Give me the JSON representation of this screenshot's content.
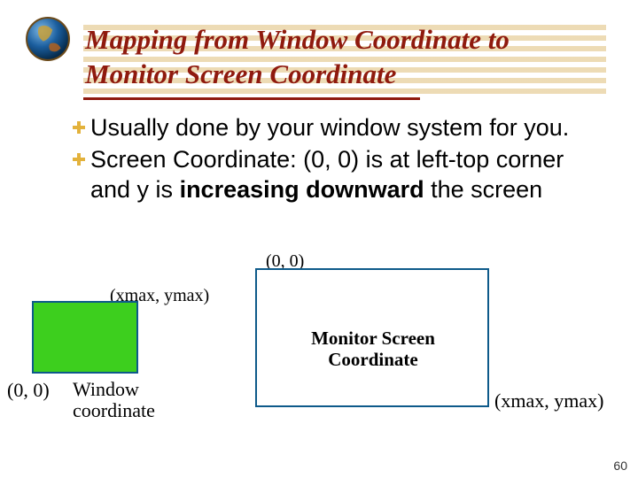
{
  "title": "Mapping from Window Coordinate to Monitor Screen Coordinate",
  "bullets": [
    {
      "text_a": "Usually done by your window system for you."
    },
    {
      "text_a": "Screen Coordinate: (0, 0) is at left-top corner and y is ",
      "bold": "increasing downward",
      "text_b": " the screen"
    }
  ],
  "diagram": {
    "origin_label": "(0, 0)",
    "max_label": "(xmax, ymax)",
    "window_label": "Window coordinate",
    "monitor_label": "Monitor Screen Coordinate"
  },
  "slide_number": "60"
}
